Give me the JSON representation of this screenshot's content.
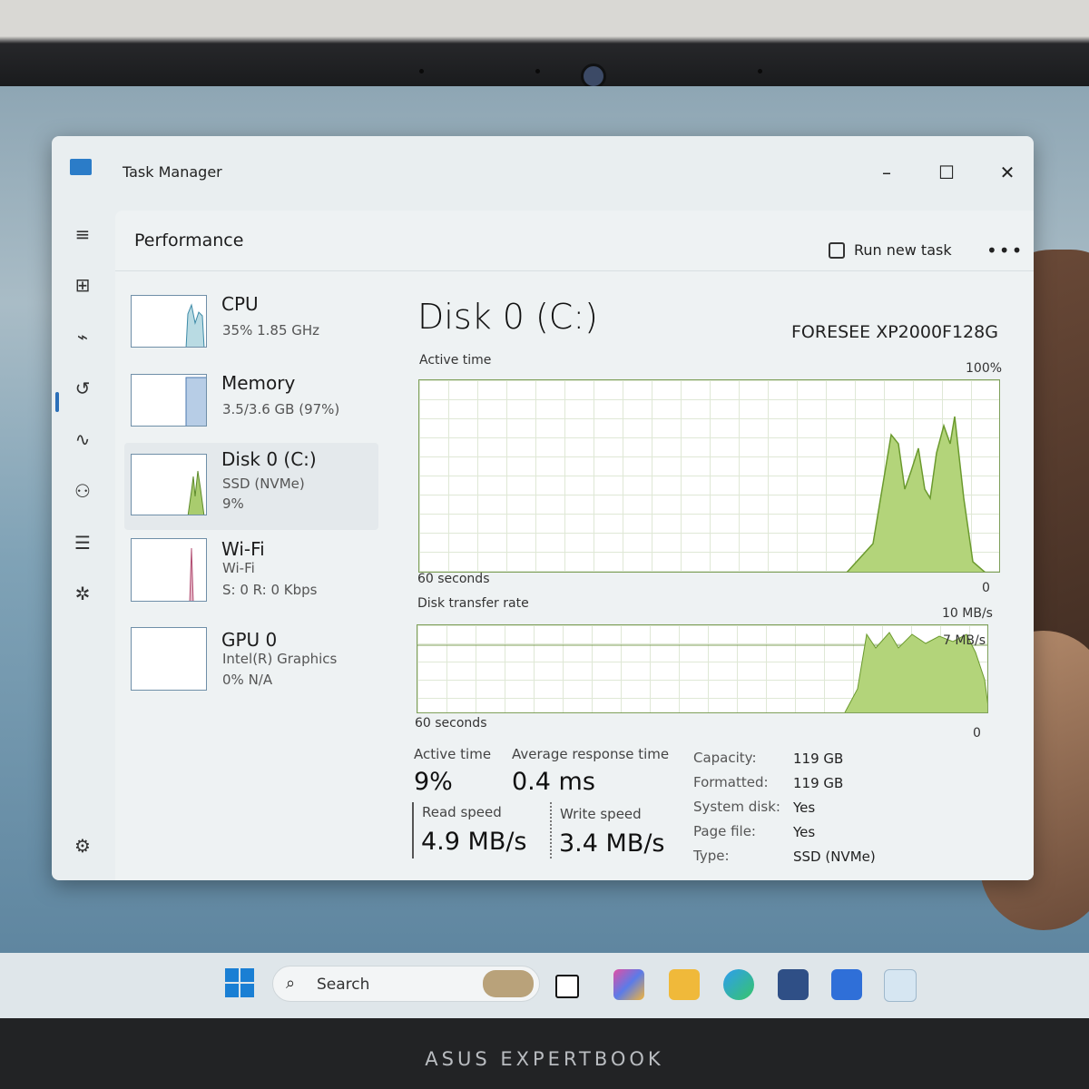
{
  "window": {
    "title": "Task Manager"
  },
  "header": {
    "section": "Performance",
    "run_task_label": "Run new task",
    "more_label": "•••"
  },
  "sidebar_list": [
    {
      "name": "CPU",
      "sub1": "35%  1.85 GHz",
      "sub2": ""
    },
    {
      "name": "Memory",
      "sub1": "3.5/3.6 GB (97%)",
      "sub2": ""
    },
    {
      "name": "Disk 0 (C:)",
      "sub1": "SSD (NVMe)",
      "sub2": "9%"
    },
    {
      "name": "Wi-Fi",
      "sub1": "Wi-Fi",
      "sub2": "S: 0 R: 0 Kbps"
    },
    {
      "name": "GPU 0",
      "sub1": "Intel(R) Graphics",
      "sub2": "0%  N/A"
    }
  ],
  "detail": {
    "title": "Disk 0 (C:)",
    "model": "FORESEE XP2000F128G",
    "active_graph": {
      "label": "Active time",
      "max_label": "100%",
      "time_label": "60 seconds",
      "min_label": "0"
    },
    "transfer_graph": {
      "label": "Disk transfer rate",
      "max_label": "10 MB/s",
      "mid_label": "7 MB/s",
      "time_label": "60 seconds",
      "min_label": "0"
    },
    "stats": {
      "active_time_label": "Active time",
      "active_time_value": "9%",
      "avg_response_label": "Average response time",
      "avg_response_value": "0.4 ms",
      "read_label": "Read speed",
      "read_value": "4.9 MB/s",
      "write_label": "Write speed",
      "write_value": "3.4 MB/s"
    },
    "props": [
      {
        "k": "Capacity:",
        "v": "119 GB"
      },
      {
        "k": "Formatted:",
        "v": "119 GB"
      },
      {
        "k": "System disk:",
        "v": "Yes"
      },
      {
        "k": "Page file:",
        "v": "Yes"
      },
      {
        "k": "Type:",
        "v": "SSD (NVMe)"
      }
    ]
  },
  "taskbar": {
    "search_label": "Search"
  },
  "device": {
    "brand": "ASUS EXPERTBOOK"
  },
  "colors": {
    "accent": "#2b6fb8",
    "disk_graph": "#8db84a"
  }
}
